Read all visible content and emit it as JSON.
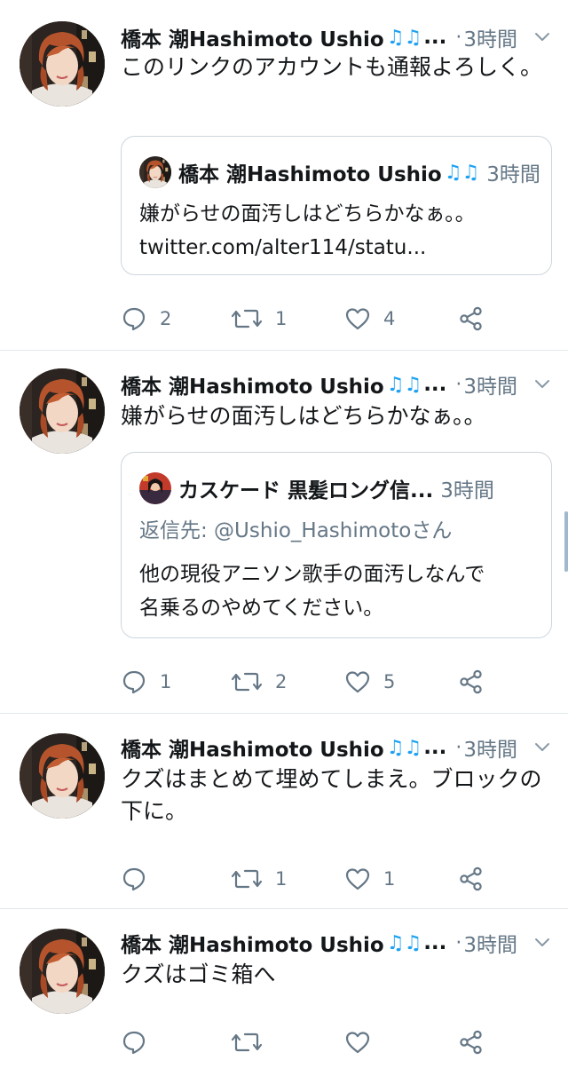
{
  "tweets": [
    {
      "author": "橋本 潮Hashimoto Ushio",
      "badge": "♫♫",
      "ellipsis": "...",
      "dot": "·",
      "time": "3時間",
      "text": "このリンクのアカウントも通報よろしく。",
      "quote": {
        "author": "橋本 潮Hashimoto Ushio",
        "badge": "♫♫",
        "time": "3時間",
        "text_line1": "嫌がらせの面汚しはどちらかなぁ。。",
        "text_line2": "twitter.com/alter114/statu..."
      },
      "replies": "2",
      "retweets": "1",
      "likes": "4"
    },
    {
      "author": "橋本 潮Hashimoto Ushio",
      "badge": "♫♫",
      "ellipsis": "...",
      "dot": "·",
      "time": "3時間",
      "text": "嫌がらせの面汚しはどちらかなぁ。。",
      "quote": {
        "author": "カスケード 黒髪ロング信...",
        "time": "3時間",
        "reply_to": "返信先: @Ushio_Hashimotoさん",
        "text_line1": "他の現役アニソン歌手の面汚しなんで",
        "text_line2": "名乗るのやめてください。"
      },
      "replies": "1",
      "retweets": "2",
      "likes": "5"
    },
    {
      "author": "橋本 潮Hashimoto Ushio",
      "badge": "♫♫",
      "ellipsis": "...",
      "dot": "·",
      "time": "3時間",
      "text": "クズはまとめて埋めてしまえ。ブロックの下に。",
      "replies": "",
      "retweets": "1",
      "likes": "1"
    },
    {
      "author": "橋本 潮Hashimoto Ushio",
      "badge": "♫♫",
      "ellipsis": "...",
      "dot": "·",
      "time": "3時間",
      "text": "クズはゴミ箱へ",
      "replies": "",
      "retweets": "",
      "likes": ""
    }
  ],
  "icons": {
    "reply": "reply-icon",
    "retweet": "retweet-icon",
    "like": "heart-icon",
    "share": "share-icon",
    "caret": "chevron-down-icon"
  },
  "colors": {
    "text": "#14171a",
    "muted": "#657786",
    "accent": "#1da1f2",
    "border": "#e1e8ed"
  }
}
